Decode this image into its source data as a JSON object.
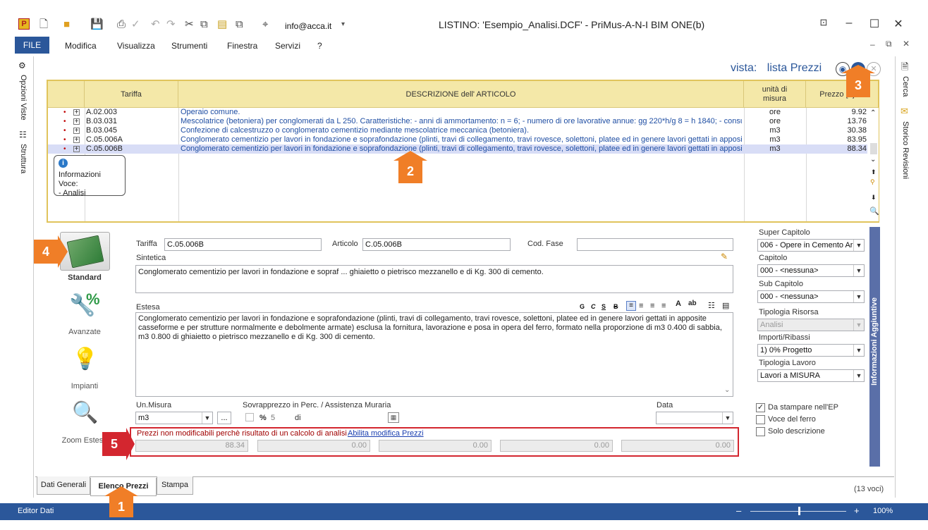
{
  "app": {
    "title": "LISTINO: 'Esempio_Analisi.DCF' - PriMus-A-N-I   BIM ONE(b)",
    "email": "info@acca.it",
    "accent": "#2b579a"
  },
  "menu": {
    "file": "FILE",
    "items": [
      "Modifica",
      "Visualizza",
      "Strumenti",
      "Finestra",
      "Servizi",
      "?"
    ]
  },
  "left_strip": {
    "opzioni_viste": "Opzioni Viste",
    "struttura": "Struttura"
  },
  "right_strip": {
    "cerca": "Cerca",
    "storico": "Storico Revisioni"
  },
  "view": {
    "prefix": "vista:",
    "name": "lista Prezzi"
  },
  "grid": {
    "headers": {
      "tariffa": "Tariffa",
      "descrizione": "DESCRIZIONE dell' ARTICOLO",
      "unita_l1": "unità di",
      "unita_l2": "misura",
      "prezzo": "Prezzo [€]"
    },
    "rows": [
      {
        "tariffa": "A.02.003",
        "descrizione": "Operaio comune.",
        "um": "ore",
        "prezzo": "9.92"
      },
      {
        "tariffa": "B.03.031",
        "descrizione": "Mescolatrice (betoniera) per conglomerati da L 250. Caratteristiche: - anni di ammortamento: n = 6; - numero di ore lavorative annue: gg 220*h/g 8 = h 1840; - consumo",
        "um": "ore",
        "prezzo": "13.76"
      },
      {
        "tariffa": "B.03.045",
        "descrizione": "Confezione di calcestruzzo o conglomerato cementizio mediante mescolatrice meccanica (betoniera).",
        "um": "m3",
        "prezzo": "30.38"
      },
      {
        "tariffa": "C.05.006A",
        "descrizione": "Conglomerato cementizio per lavori in fondazione e soprafondazione (plinti, travi di collegamento, travi rovesce, solettoni, platee ed in genere lavori gettati in appositi",
        "um": "m3",
        "prezzo": "83.95"
      },
      {
        "tariffa": "C.05.006B",
        "descrizione": "Conglomerato cementizio per lavori in fondazione e soprafondazione (plinti, travi di collegamento, travi rovesce, solettoni, platee ed in genere lavori gettati in appositi",
        "um": "m3",
        "prezzo": "88.34"
      }
    ]
  },
  "tooltip": {
    "line1": "Informazioni Voce:",
    "line2": "- Analisi"
  },
  "badges": [
    "1",
    "2",
    "3",
    "4",
    "5"
  ],
  "sidebar_modes": [
    {
      "label": "Standard"
    },
    {
      "label": "Avanzate"
    },
    {
      "label": "Impianti"
    },
    {
      "label": "Zoom Estesa"
    }
  ],
  "form": {
    "tariffa_label": "Tariffa",
    "tariffa_value": "C.05.006B",
    "articolo_label": "Articolo",
    "articolo_value": "C.05.006B",
    "codfase_label": "Cod. Fase",
    "codfase_value": "",
    "sintetica_label": "Sintetica",
    "sintetica_value": "Conglomerato cementizio per lavori in fondazione e sopraf ...  ghiaietto o pietrisco mezzanello e di Kg. 300 di cemento.",
    "estesa_label": "Estesa",
    "estesa_value": "Conglomerato cementizio per lavori in fondazione e soprafondazione (plinti, travi di collegamento, travi rovesce, solettoni, platee ed in genere lavori gettati in apposite casseforme e per strutture normalmente e debolmente armate) esclusa la fornitura, lavorazione e posa in opera del ferro, formato nella proporzione di m3 0.400 di sabbia, m3 0.800 di ghiaietto o pietrisco mezzanello e di Kg. 300 di cemento.",
    "format_buttons": [
      "G",
      "C",
      "S",
      "B"
    ],
    "unmisura_label": "Un.Misura",
    "unmisura_value": "m3",
    "ellipsis": "...",
    "sovrapprezzo_label": "Sovrapprezzo in Perc. / Assistenza Muraria",
    "perc_symbol": "%",
    "perc_value": "5",
    "di_label": "di",
    "data_label": "Data",
    "data_value": ""
  },
  "prezzi": {
    "warning": "Prezzi non modificabili perchè risultato di un calcolo di analisi",
    "link": "Abilita modifica Prezzi",
    "values": [
      "88.34",
      "0.00",
      "0.00",
      "0.00",
      "0.00"
    ]
  },
  "right_panel": {
    "super_capitolo_label": "Super Capitolo",
    "super_capitolo_value": "006 - Opere in Cemento Ar",
    "capitolo_label": "Capitolo",
    "capitolo_value": "000 - <nessuna>",
    "sub_capitolo_label": "Sub Capitolo",
    "sub_capitolo_value": "000 - <nessuna>",
    "tipologia_risorsa_label": "Tipologia Risorsa",
    "tipologia_risorsa_value": "Analisi",
    "importi_label": "Importi/Ribassi",
    "importi_value": "1)  0%  Progetto",
    "tipologia_lavoro_label": "Tipologia Lavoro",
    "tipologia_lavoro_value": "Lavori a MISURA",
    "info_aggiuntive": "Informazioni Aggiuntive",
    "checks": [
      {
        "label": "Da stampare nell'EP",
        "checked": true
      },
      {
        "label": "Voce del ferro",
        "checked": false
      },
      {
        "label": "Solo descrizione",
        "checked": false
      }
    ]
  },
  "tabs": [
    "Dati Generali",
    "Elenco Prezzi",
    "Stampa"
  ],
  "count": "(13 voci)",
  "status": {
    "left": "Editor Dati",
    "zoom": "100%",
    "zoom_fraction": 0.5
  }
}
